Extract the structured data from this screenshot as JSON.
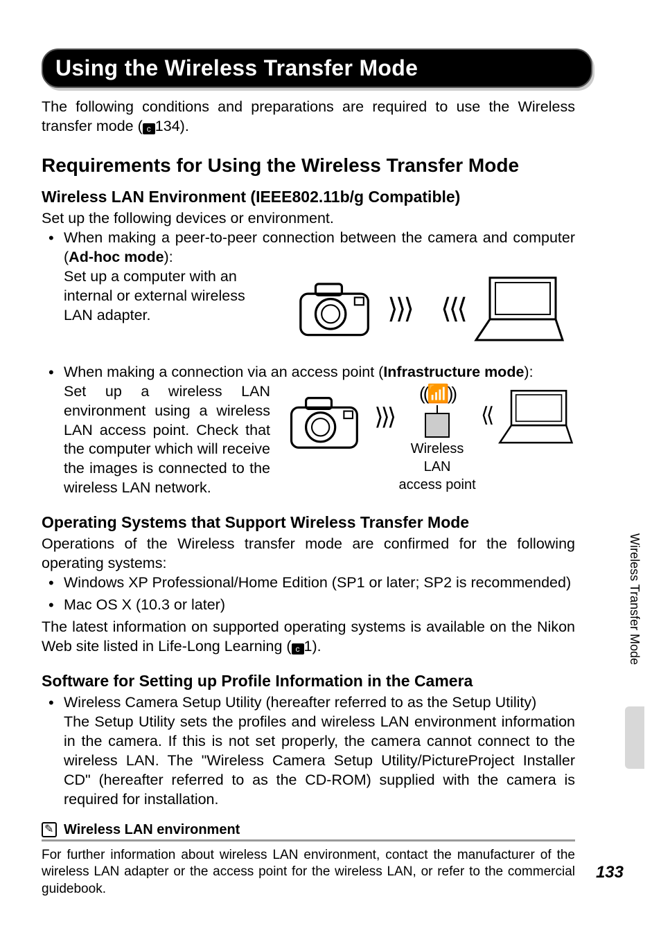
{
  "title": "Using the Wireless Transfer Mode",
  "intro_a": "The following conditions and preparations are required to use the Wireless transfer mode (",
  "intro_ref": "134).",
  "h2": "Requirements for Using the Wireless Transfer Mode",
  "wlan": {
    "h3": "Wireless LAN Environment (IEEE802.11b/g Compatible)",
    "lead": "Set up the following devices or environment.",
    "li1a": "When making a peer-to-peer connection between the camera and computer (",
    "li1b": "Ad-hoc mode",
    "li1c": "):",
    "li1d": "Set up a computer with an internal or external wireless LAN adapter.",
    "li2a": "When making a connection via an access point (",
    "li2b": "Infrastructure mode",
    "li2c": "):",
    "li2d": "Set up a wireless LAN environment using a wireless LAN access point. Check that the computer which will receive the images is connected to the wireless LAN network.",
    "ap_label1": "Wireless LAN",
    "ap_label2": "access point"
  },
  "os": {
    "h3": "Operating Systems that Support Wireless Transfer Mode",
    "lead": "Operations of the Wireless transfer mode are confirmed for the following operating systems:",
    "li1": "Windows XP Professional/Home Edition (SP1 or later; SP2 is recommended)",
    "li2": "Mac OS X (10.3 or later)",
    "tail_a": "The latest information on supported operating systems is available on the Nikon Web site listed in Life-Long Learning (",
    "tail_b": "1)."
  },
  "sw": {
    "h3": "Software for Setting up Profile Information in the Camera",
    "li1a": "Wireless Camera Setup Utility (hereafter referred to as the Setup Utility)",
    "li1b": "The Setup Utility sets the profiles and wireless LAN environment information in the camera. If this is not set properly, the camera cannot connect to the wireless LAN. The \"Wireless Camera Setup Utility/PictureProject Installer CD\" (hereafter referred to as the CD-ROM) supplied with the camera is required for installation."
  },
  "note": {
    "title": "Wireless LAN environment",
    "body": "For further information about wireless LAN environment, contact the manufacturer of the wireless LAN adapter or the access point for the wireless LAN, or refer to the commercial guidebook."
  },
  "side": "Wireless Transfer Mode",
  "page": "133",
  "icons": {
    "ref": "c"
  }
}
